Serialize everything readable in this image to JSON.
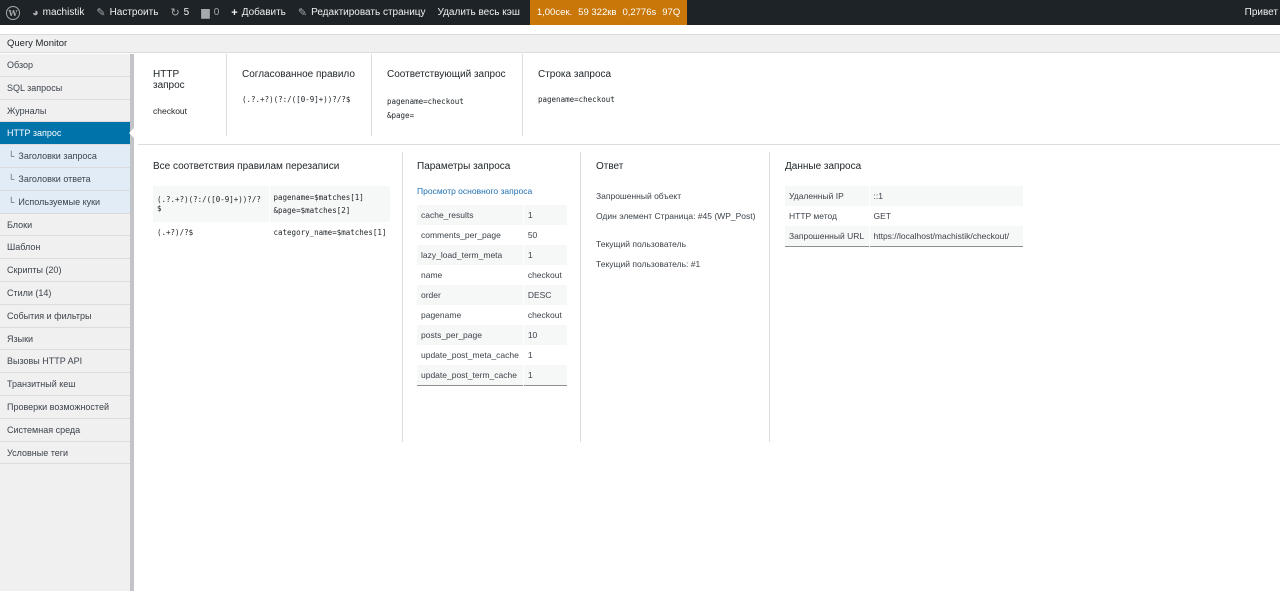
{
  "adminbar": {
    "site_name": "machistik",
    "customize": "Настроить",
    "updates_count": "5",
    "comments_count": "0",
    "add_new": "Добавить",
    "edit_page": "Редактировать страницу",
    "clear_cache": "Удалить весь кэш",
    "qm": {
      "time": "1,00сек.",
      "memory": "59 322кв",
      "query_time": "0,2776s",
      "queries": "97Q"
    },
    "greeting": "Привет"
  },
  "panel_title": "Query Monitor",
  "sidebar": {
    "items": [
      {
        "label": "Обзор"
      },
      {
        "label": "SQL запросы"
      },
      {
        "label": "Журналы"
      },
      {
        "label": "HTTP запрос",
        "active": true
      },
      {
        "label": "Заголовки запроса",
        "sub": true
      },
      {
        "label": "Заголовки ответа",
        "sub": true
      },
      {
        "label": "Используемые куки",
        "sub": true
      },
      {
        "label": "Блоки"
      },
      {
        "label": "Шаблон"
      },
      {
        "label": "Скрипты (20)"
      },
      {
        "label": "Стили (14)"
      },
      {
        "label": "События и фильтры"
      },
      {
        "label": "Языки"
      },
      {
        "label": "Вызовы HTTP API"
      },
      {
        "label": "Транзитный кеш"
      },
      {
        "label": "Проверки возможностей"
      },
      {
        "label": "Системная среда"
      },
      {
        "label": "Условные теги"
      }
    ],
    "sub_prefix": "└"
  },
  "top": {
    "http_request": {
      "title": "HTTP запрос",
      "value": "checkout"
    },
    "matched_rule": {
      "title": "Согласованное правило",
      "value": "(.?.+?)(?:/([0-9]+))?/?$"
    },
    "matched_query": {
      "title": "Соответствующий запрос",
      "line1": "pagename=checkout",
      "line2": "&page="
    },
    "query_string": {
      "title": "Строка запроса",
      "value": "pagename=checkout"
    }
  },
  "rewrite": {
    "title": "Все соответствия правилам перезаписи",
    "rows": [
      {
        "rule": "(.?.+?)(?:/([0-9]+))?/?$",
        "query1": "pagename=$matches[1]",
        "query2": "&page=$matches[2]"
      },
      {
        "rule": "(.+?)/?$",
        "query1": "category_name=$matches[1]",
        "query2": ""
      }
    ]
  },
  "params": {
    "title": "Параметры запроса",
    "link": "Просмотр основного запроса",
    "rows": [
      {
        "k": "cache_results",
        "v": "1"
      },
      {
        "k": "comments_per_page",
        "v": "50"
      },
      {
        "k": "lazy_load_term_meta",
        "v": "1"
      },
      {
        "k": "name",
        "v": "checkout"
      },
      {
        "k": "order",
        "v": "DESC"
      },
      {
        "k": "pagename",
        "v": "checkout"
      },
      {
        "k": "posts_per_page",
        "v": "10"
      },
      {
        "k": "update_post_meta_cache",
        "v": "1"
      },
      {
        "k": "update_post_term_cache",
        "v": "1"
      }
    ]
  },
  "response": {
    "title": "Ответ",
    "queried_object_label": "Запрошенный объект",
    "queried_object_value": "Один элемент Страница: #45 (WP_Post)",
    "current_user_label": "Текущий пользователь",
    "current_user_value": "Текущий пользователь: #1"
  },
  "request_data": {
    "title": "Данные запроса",
    "rows": [
      {
        "k": "Удаленный IP",
        "v": "::1"
      },
      {
        "k": "HTTP метод",
        "v": "GET"
      },
      {
        "k": "Запрошенный URL",
        "v": "https://localhost/machistik/checkout/"
      }
    ]
  }
}
